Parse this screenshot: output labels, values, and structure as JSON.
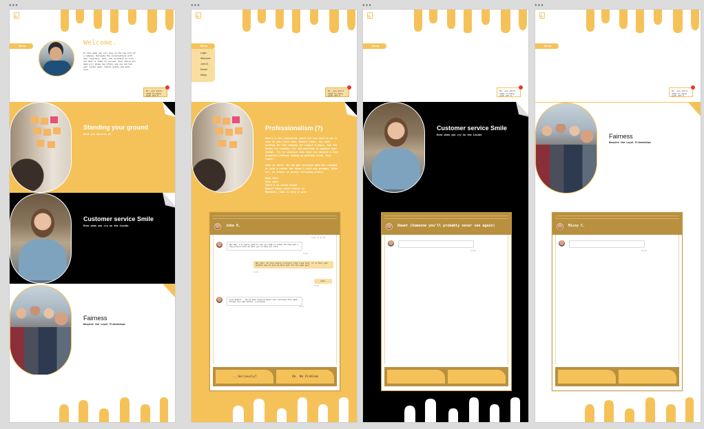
{
  "frames": [
    "▪▪▪",
    "▪▪▪",
    "▪▪▪",
    "▪▪▪"
  ],
  "menu": {
    "label": "Menu",
    "items": [
      "Login",
      "Welcome",
      "John D.",
      "Dewet",
      "Missy"
    ]
  },
  "note": {
    "text": "Hi, you still need to help with ITT 5"
  },
  "welcome": {
    "title": "Welcome.",
    "body": "In this game you will play as the new hire at a company. Navigate the conversations with your coworkers, boss, and customers to find out what it takes to succeed. Each choice you make will shape how others see you and how your career goes. Choose wisely and good luck."
  },
  "sections": [
    {
      "title": "Standing your ground",
      "subtitle": "What you deserve IS"
    },
    {
      "title": "Customer service Smile",
      "subtitle": "Even when you cry on the inside"
    },
    {
      "title": "Fairness",
      "subtitle": "Despite the Loyal Friendships"
    }
  ],
  "professionalism": {
    "title": "Professionalism (?)",
    "paragraphs": [
      "Here's a fun simulation where all you need to do is talk to your boss John. Robert (You), has been working for the company for almost 4 years, but the bosses've randomly for the workload to nowhere near enough. Try to convince John that you deserve a fair promotion without ending up getting fired. Easy right?",
      "John is chill. He can get stressed when he's handed us into a corner but doesn't hold any grudges. After all, he thinks he merely following orders.",
      "Keep Calm\nStay sane\nThere's no wrong answer\nDewayt Dimos whose thesis is\nRemember, this is only a sale."
    ]
  },
  "chats": [
    {
      "name": "John D.",
      "stamp_top": "Today 12:00 PM",
      "messages": [
        {
          "text": "Hey Rob, I'm really glad to see you came in today! We have got a big project that we want you to help out with.",
          "time": "12:01"
        },
        {
          "text": "Hey John. Is this really a project like I was told, or is this just another way to give me more work for the same pay?",
          "time": "12:02",
          "mine": true
        },
        {
          "text": "Yeah.",
          "time": "12:02",
          "mine": true
        },
        {
          "text": "Look Robert... We've been talking about your workload this week. Things will get better, I promise.",
          "time": "12:03"
        }
      ],
      "buttons": [
        "...Seriously?",
        "Ok. No Problem"
      ]
    },
    {
      "name": "Dewet (Someone you'll probably never see again)",
      "messages": [
        {
          "text": "",
          "time": "12:00"
        }
      ],
      "buttons": [
        "",
        ""
      ]
    },
    {
      "name": "Missy C.",
      "messages": [
        {
          "text": "",
          "time": "12:00"
        }
      ],
      "buttons": [
        "",
        ""
      ]
    }
  ],
  "colors": {
    "accent": "#f5c25a",
    "accent_dark": "#b8903f",
    "black": "#000000",
    "white": "#ffffff",
    "alert": "#e53935"
  }
}
